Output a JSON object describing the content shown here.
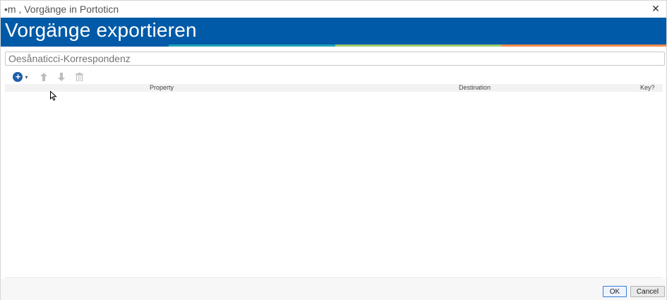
{
  "window": {
    "title": "•m , Vorgänge in Portoticn",
    "close_glyph": "✕"
  },
  "banner": {
    "heading": "Vorgänge exportieren",
    "colors": [
      "#005aa7",
      "#1aa3b8",
      "#9cc96b",
      "#f08a4b"
    ]
  },
  "export_name": {
    "placeholder": "Oesånaticci-Korrespondenz"
  },
  "toolbar": {
    "add_icon": "plus-circle-icon",
    "up_icon": "arrow-up-icon",
    "down_icon": "arrow-down-icon",
    "delete_icon": "trash-icon"
  },
  "table": {
    "columns": [
      "Property",
      "Destination",
      "Key?"
    ],
    "rows": []
  },
  "footer": {
    "ok_label": "OK",
    "cancel_label": "Cancel"
  }
}
